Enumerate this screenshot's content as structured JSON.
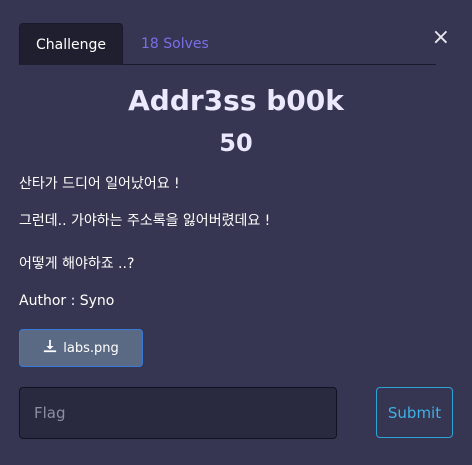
{
  "tabs": {
    "challenge": "Challenge",
    "solves": "18 Solves"
  },
  "close_symbol": "×",
  "challenge": {
    "name": "Addr3ss b00k",
    "points": "50",
    "description": [
      "산타가 드디어 일어났어요 !",
      "그런데.. 가야하는 주소록을 잃어버렸데요 !",
      "어떻게 해야하죠 ..?",
      "Author : Syno"
    ]
  },
  "file": {
    "label": "labs.png",
    "icon": "download-icon"
  },
  "flag_input": {
    "placeholder": "Flag",
    "value": ""
  },
  "submit_label": "Submit"
}
